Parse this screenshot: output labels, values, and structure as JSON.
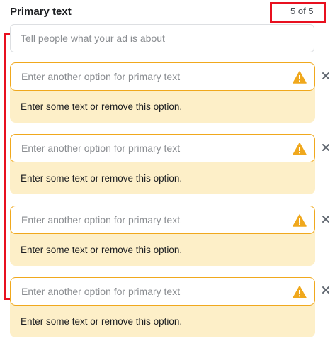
{
  "header": {
    "title": "Primary text",
    "counter": "5 of 5"
  },
  "primary_input": {
    "placeholder": "Tell people what your ad is about"
  },
  "options": [
    {
      "placeholder": "Enter another option for primary text",
      "message": "Enter some text or remove this option.",
      "icon": "warning-triangle-icon"
    },
    {
      "placeholder": "Enter another option for primary text",
      "message": "Enter some text or remove this option.",
      "icon": "warning-triangle-icon"
    },
    {
      "placeholder": "Enter another option for primary text",
      "message": "Enter some text or remove this option.",
      "icon": "warning-triangle-icon"
    },
    {
      "placeholder": "Enter another option for primary text",
      "message": "Enter some text or remove this option.",
      "icon": "warning-triangle-icon"
    }
  ],
  "colors": {
    "warning": "#f0a81d",
    "warning_bg": "#fdefc8",
    "annotation": "#e8101f"
  }
}
